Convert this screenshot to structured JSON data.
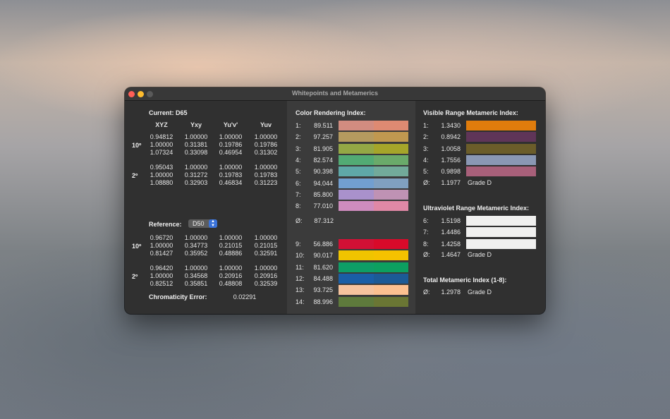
{
  "window": {
    "title": "Whitepoints and Metamerics"
  },
  "left": {
    "current_label": "Current: D65",
    "col_headers": [
      "XYZ",
      "Yxy",
      "Yu'v'",
      "Yuv"
    ],
    "current_rows": [
      {
        "label": "10º",
        "cols": [
          [
            "0.94812",
            "1.00000",
            "1.07324"
          ],
          [
            "1.00000",
            "0.31381",
            "0.33098"
          ],
          [
            "1.00000",
            "0.19786",
            "0.46954"
          ],
          [
            "1.00000",
            "0.19786",
            "0.31302"
          ]
        ]
      },
      {
        "label": "2º",
        "cols": [
          [
            "0.95043",
            "1.00000",
            "1.08880"
          ],
          [
            "1.00000",
            "0.31272",
            "0.32903"
          ],
          [
            "1.00000",
            "0.19783",
            "0.46834"
          ],
          [
            "1.00000",
            "0.19783",
            "0.31223"
          ]
        ]
      }
    ],
    "reference_label": "Reference:",
    "reference_value": "D50",
    "reference_rows": [
      {
        "label": "10º",
        "cols": [
          [
            "0.96720",
            "1.00000",
            "0.81427"
          ],
          [
            "1.00000",
            "0.34773",
            "0.35952"
          ],
          [
            "1.00000",
            "0.21015",
            "0.48886"
          ],
          [
            "1.00000",
            "0.21015",
            "0.32591"
          ]
        ]
      },
      {
        "label": "2º",
        "cols": [
          [
            "0.96420",
            "1.00000",
            "0.82512"
          ],
          [
            "1.00000",
            "0.34568",
            "0.35851"
          ],
          [
            "1.00000",
            "0.20916",
            "0.48808"
          ],
          [
            "1.00000",
            "0.20916",
            "0.32539"
          ]
        ]
      }
    ],
    "chroma_label": "Chromaticity Error:",
    "chroma_value": "0.02291"
  },
  "cri": {
    "title": "Color Rendering Index:",
    "rows": [
      {
        "idx": "1:",
        "val": "89.511",
        "c1": "#d28c80",
        "c2": "#de8a72"
      },
      {
        "idx": "2:",
        "val": "97.257",
        "c1": "#b59a5f",
        "c2": "#c09850"
      },
      {
        "idx": "3:",
        "val": "81.905",
        "c1": "#94a845",
        "c2": "#a5a52a"
      },
      {
        "idx": "4:",
        "val": "82.574",
        "c1": "#52ab74",
        "c2": "#6aaa6a"
      },
      {
        "idx": "5:",
        "val": "90.398",
        "c1": "#5fa8a8",
        "c2": "#72aa9a"
      },
      {
        "idx": "6:",
        "val": "94.044",
        "c1": "#729fd0",
        "c2": "#80a0c0"
      },
      {
        "idx": "7:",
        "val": "85.800",
        "c1": "#a991cc",
        "c2": "#bf92b4"
      },
      {
        "idx": "8:",
        "val": "77.010",
        "c1": "#cf8cbe",
        "c2": "#e088a6"
      }
    ],
    "avg_label": "Ø:",
    "avg_value": "87.312",
    "special_rows": [
      {
        "idx": "9:",
        "val": "56.886",
        "c1": "#d21035",
        "c2": "#d80a2a"
      },
      {
        "idx": "10:",
        "val": "90.017",
        "c1": "#f0c400",
        "c2": "#f5c200"
      },
      {
        "idx": "11:",
        "val": "81.620",
        "c1": "#0e9e66",
        "c2": "#0ca060"
      },
      {
        "idx": "12:",
        "val": "84.488",
        "c1": "#1a5ea6",
        "c2": "#1c5a96"
      },
      {
        "idx": "13:",
        "val": "93.725",
        "c1": "#f6c39e",
        "c2": "#fcc090"
      },
      {
        "idx": "14:",
        "val": "88.996",
        "c1": "#5e7a3c",
        "c2": "#6a7634"
      }
    ]
  },
  "vis": {
    "title": "Visible Range Metameric Index:",
    "rows": [
      {
        "idx": "1:",
        "val": "1.3430",
        "color": "#e07c0c"
      },
      {
        "idx": "2:",
        "val": "0.8942",
        "color": "#5f3558"
      },
      {
        "idx": "3:",
        "val": "1.0058",
        "color": "#6b5d2a"
      },
      {
        "idx": "4:",
        "val": "1.7556",
        "color": "#8a98b4"
      },
      {
        "idx": "5:",
        "val": "0.9898",
        "color": "#a8607a"
      }
    ],
    "avg_label": "Ø:",
    "avg_value": "1.1977",
    "grade": "Grade D"
  },
  "uv": {
    "title": "Ultraviolet Range Metameric Index:",
    "rows": [
      {
        "idx": "6:",
        "val": "1.5198",
        "color": "#f0f0ef"
      },
      {
        "idx": "7:",
        "val": "1.4486",
        "color": "#f0f0ef"
      },
      {
        "idx": "8:",
        "val": "1.4258",
        "color": "#f0f0ef"
      }
    ],
    "avg_label": "Ø:",
    "avg_value": "1.4647",
    "grade": "Grade D"
  },
  "total": {
    "title": "Total Metameric Index (1-8):",
    "avg_label": "Ø:",
    "avg_value": "1.2978",
    "grade": "Grade D"
  }
}
